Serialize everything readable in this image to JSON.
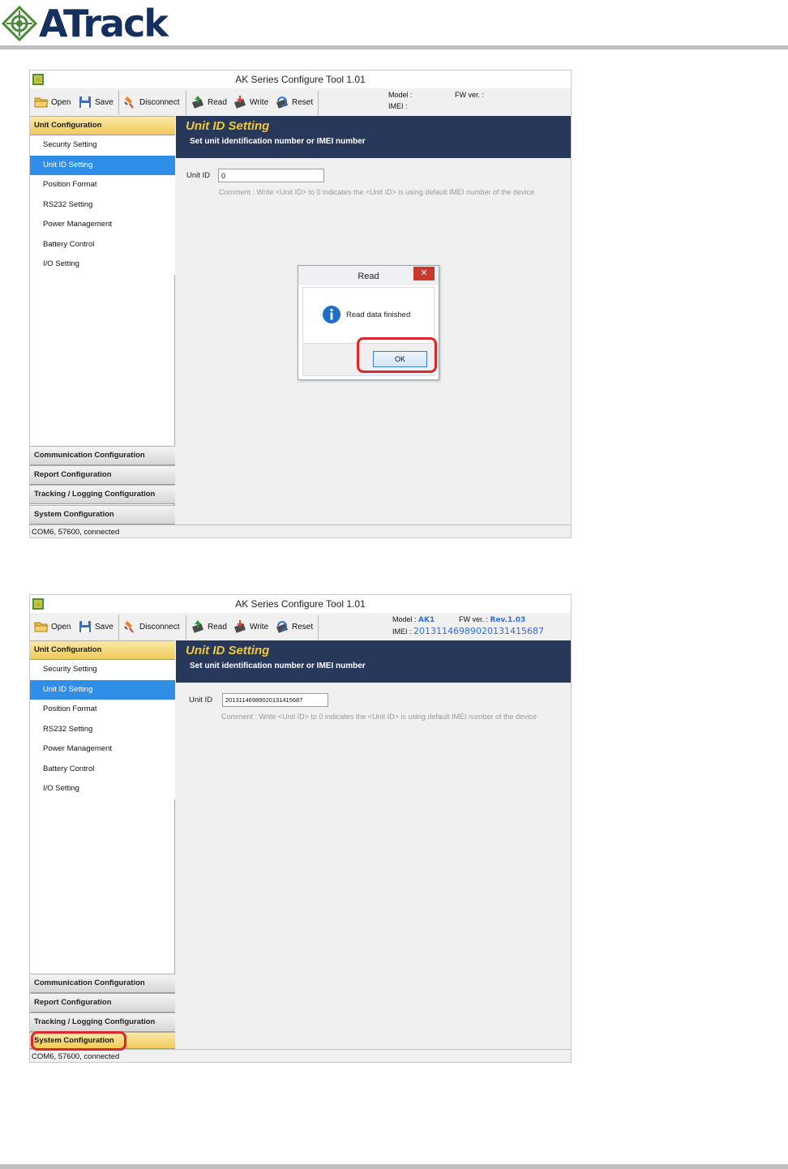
{
  "brand": {
    "name": "ATrack",
    "color": "#15305e",
    "mark_color": "#4b8a3a"
  },
  "app_title": "AK Series Configure Tool 1.01",
  "toolbar": {
    "open_label": "Open",
    "save_label": "Save",
    "disconnect_label": "Disconnect",
    "read_label": "Read",
    "write_label": "Write",
    "reset_label": "Reset",
    "model_label": "Model :",
    "fw_label": "FW ver. :",
    "imei_label": "IMEI :"
  },
  "nav": {
    "unit_configuration": "Unit Configuration",
    "items": [
      {
        "label": "Security Setting"
      },
      {
        "label": "Unit ID Setting",
        "selected": true
      },
      {
        "label": "Position Format"
      },
      {
        "label": "RS232 Setting"
      },
      {
        "label": "Power Management"
      },
      {
        "label": "Battery Control"
      },
      {
        "label": "I/O Setting"
      }
    ],
    "communication_configuration": "Communication Configuration",
    "report_configuration": "Report Configuration",
    "tracking_configuration": "Tracking / Logging Configuration",
    "system_configuration": "System Configuration"
  },
  "content": {
    "banner_title": "Unit ID Setting",
    "banner_subtitle": "Set unit identification number or IMEI number",
    "unit_id_label": "Unit ID",
    "comment": "Comment : Write <Unit ID> to 0 indicates the <Unit ID> is using default IMEI number of the device"
  },
  "status": "COM6, 57600, connected",
  "screen1": {
    "unit_id_value": "0",
    "model_value": "",
    "fw_value": "",
    "imei_value": ""
  },
  "screen2": {
    "unit_id_value": "201311469890201314156​87",
    "model_value": "AK1",
    "fw_value": "Rev.1.03",
    "imei_value": "201311469890201314156​87"
  },
  "dialog": {
    "title": "Read",
    "message": "Read data finished",
    "ok_label": "OK",
    "close_glyph": "✕"
  },
  "colors": {
    "banner_bg": "#27385b",
    "banner_title": "#f2c93a",
    "selection": "#2f8ee8",
    "highlight_ring": "#e0262d",
    "header_value_blue": "#2f6fd6"
  }
}
